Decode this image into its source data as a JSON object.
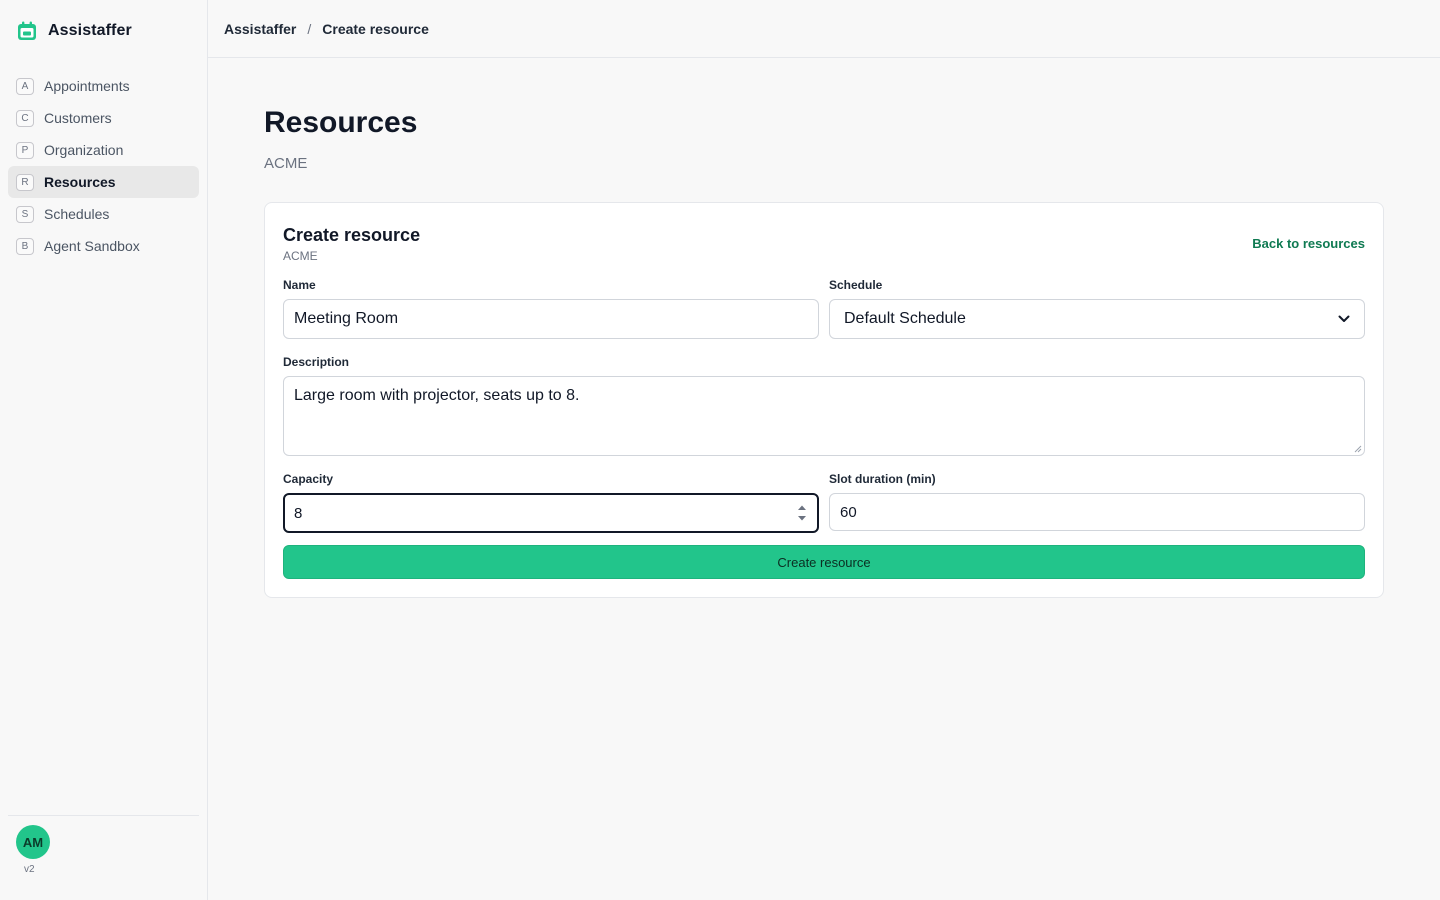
{
  "app": {
    "name": "Assistaffer",
    "version": "v2",
    "user_initials": "AM",
    "accent_color": "#22c58b"
  },
  "sidebar": {
    "items": [
      {
        "key": "A",
        "label": "Appointments",
        "icon": "letter-key-icon",
        "active": false
      },
      {
        "key": "C",
        "label": "Customers",
        "icon": "letter-key-icon",
        "active": false
      },
      {
        "key": "P",
        "label": "Organization",
        "icon": "letter-key-icon",
        "active": false
      },
      {
        "key": "R",
        "label": "Resources",
        "icon": "letter-key-icon",
        "active": true
      },
      {
        "key": "S",
        "label": "Schedules",
        "icon": "letter-key-icon",
        "active": false
      },
      {
        "key": "B",
        "label": "Agent Sandbox",
        "icon": "letter-key-icon",
        "active": false
      }
    ]
  },
  "breadcrumb": {
    "root": "Assistaffer",
    "separator": "/",
    "current": "Create resource"
  },
  "page": {
    "title": "Resources",
    "subtitle": "ACME"
  },
  "form": {
    "title": "Create resource",
    "subtitle": "ACME",
    "back_link": "Back to resources",
    "name": {
      "label": "Name",
      "value": "Meeting Room"
    },
    "schedule": {
      "label": "Schedule",
      "value": "Default Schedule"
    },
    "description": {
      "label": "Description",
      "value": "Large room with projector, seats up to 8."
    },
    "capacity": {
      "label": "Capacity",
      "value": "8"
    },
    "slot_duration": {
      "label": "Slot duration (min)",
      "value": "60"
    },
    "submit_label": "Create resource"
  }
}
